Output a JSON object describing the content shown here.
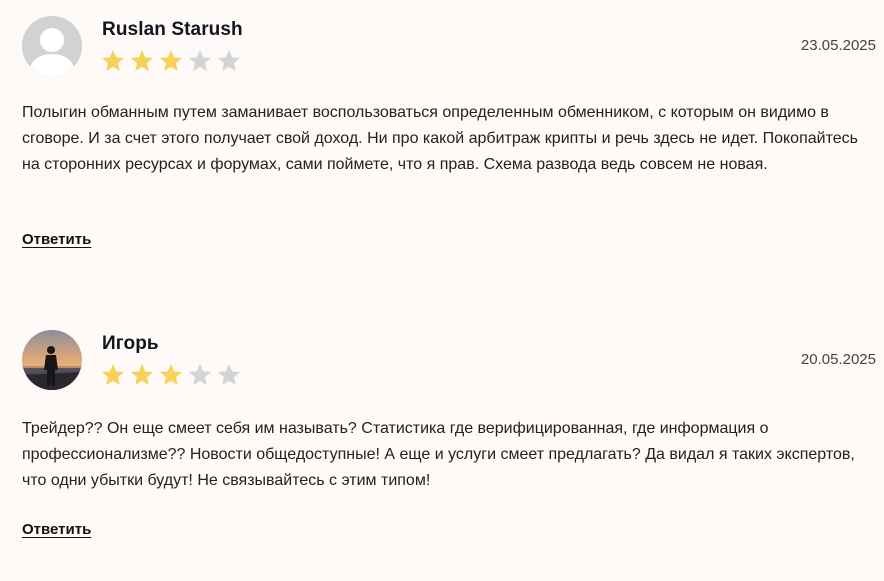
{
  "reviews": [
    {
      "author": "Ruslan Starush",
      "rating": 3,
      "max_rating": 5,
      "date": "23.05.2025",
      "text": "Полыгин обманным путем заманивает воспользоваться определенным обменником, с которым он видимо в сговоре. И за счет этого получает свой доход. Ни про какой арбитраж крипты и речь здесь не идет. Покопайтесь на сторонних ресурсах и форумах, сами поймете, что я прав. Схема развода ведь совсем не новая.",
      "reply_label": "Ответить",
      "avatar": "user-placeholder-icon"
    },
    {
      "author": "Игорь",
      "rating": 3,
      "max_rating": 5,
      "date": "20.05.2025",
      "text": "Трейдер?? Он еще смеет себя им называть? Статистика где верифицированная, где информация о профессионализме?? Новости общедоступные! А еще и услуги смеет предлагать? Да видал я таких экспертов, что одни убытки будут! Не связывайтесь с этим типом!",
      "reply_label": "Ответить",
      "avatar": "user-photo-sunset"
    }
  ],
  "colors": {
    "star_filled": "#f7d25a",
    "star_empty": "#d4d4d4",
    "background": "#fdfaf7"
  }
}
